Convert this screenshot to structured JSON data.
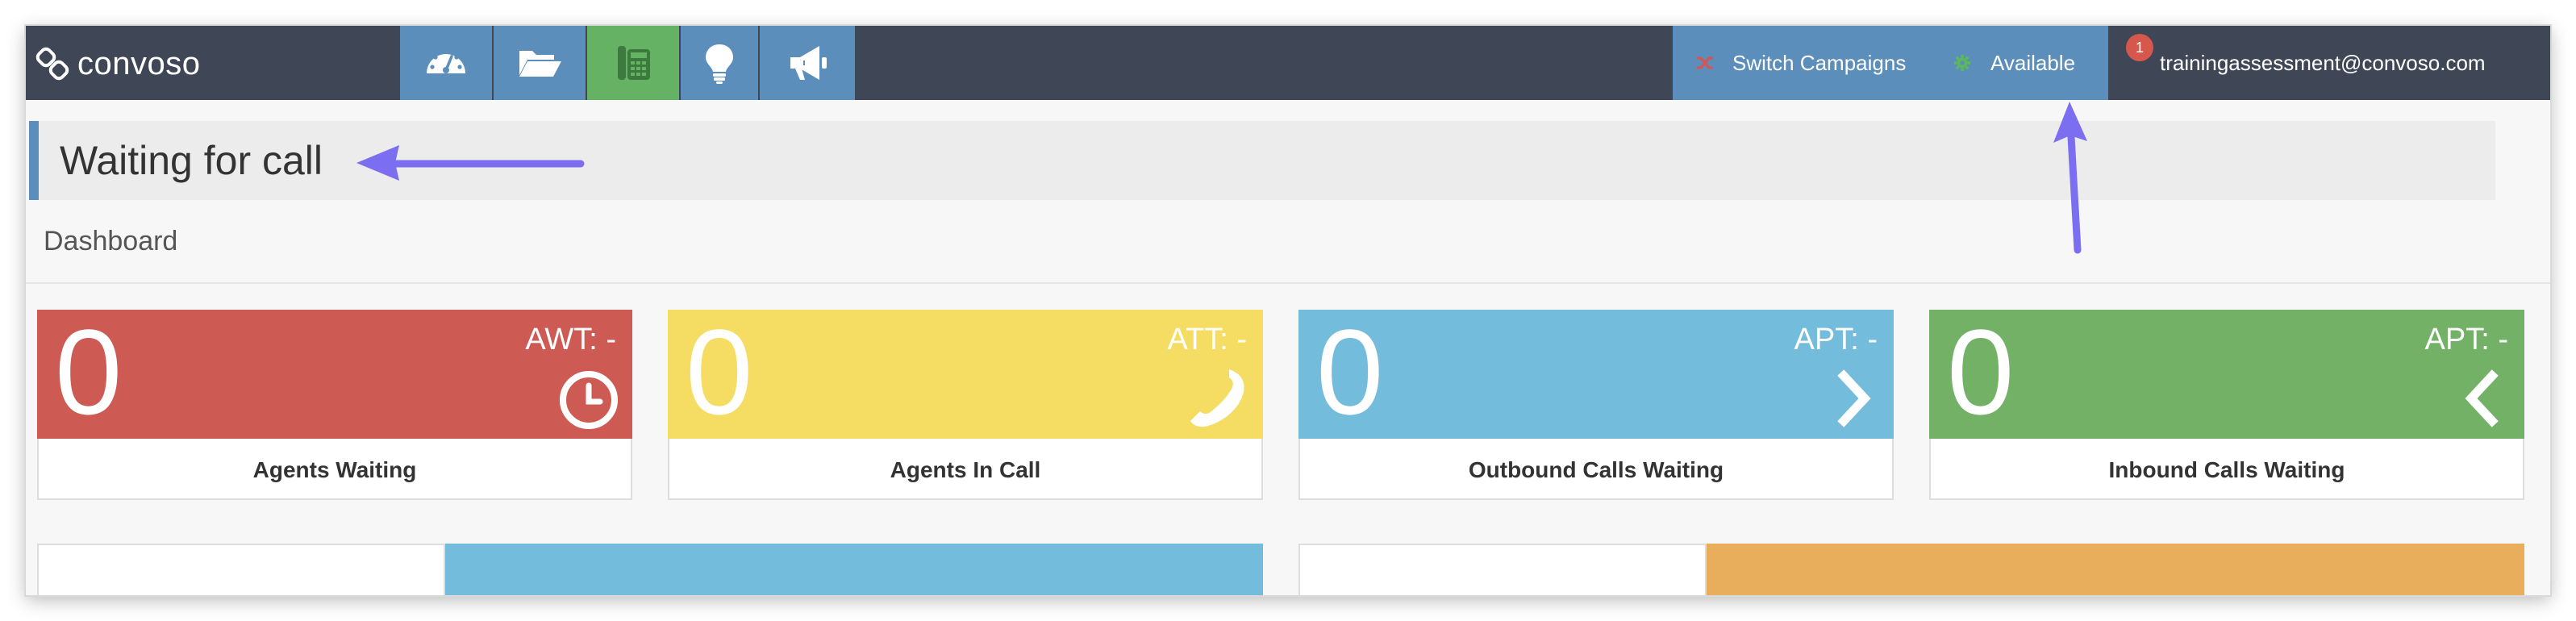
{
  "app": {
    "logo_text": "convoso"
  },
  "nav": {
    "items": [
      {
        "icon": "dashboard-gauge-icon"
      },
      {
        "icon": "folder-open-icon"
      },
      {
        "icon": "phone-dialpad-icon"
      },
      {
        "icon": "lightbulb-icon"
      },
      {
        "icon": "megaphone-icon"
      }
    ]
  },
  "topbar": {
    "switch_campaigns": "Switch Campaigns",
    "availability": "Available",
    "notification_count": "1",
    "user_email": "trainingassessment@convoso.com"
  },
  "status": {
    "text": "Waiting for call"
  },
  "breadcrumb": {
    "label": "Dashboard"
  },
  "cards": [
    {
      "value": "0",
      "metric": "AWT: -",
      "label": "Agents Waiting",
      "color": "#cd5b53",
      "icon": "clock-icon"
    },
    {
      "value": "0",
      "metric": "ATT: -",
      "label": "Agents In Call",
      "color": "#f5dd63",
      "icon": "phone-icon"
    },
    {
      "value": "0",
      "metric": "APT: -",
      "label": "Outbound Calls Waiting",
      "color": "#74bcdc",
      "icon": "chevron-right-icon"
    },
    {
      "value": "0",
      "metric": "APT: -",
      "label": "Inbound Calls Waiting",
      "color": "#72b166",
      "icon": "chevron-left-icon"
    }
  ],
  "colors": {
    "topbar": "#3f4756",
    "nav": "#5b8ebb",
    "nav_active": "#66b265",
    "annotation_arrow": "#7b6ef0",
    "panel_blue": "#74bcdc",
    "panel_orange": "#e9ae5c"
  }
}
